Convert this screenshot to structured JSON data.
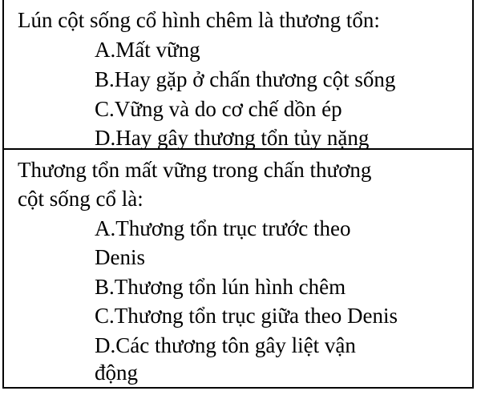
{
  "questions": [
    {
      "lines": [
        "Lún cột sống cổ hình chêm là thương tổn:"
      ],
      "options": [
        "A.Mất vững",
        "B.Hay gặp ở chấn thương cột sống",
        "C.Vững và do cơ chế dồn ép",
        "D.Hay gây thương tổn tủy nặng"
      ]
    },
    {
      "lines": [
        "Thương tổn mất vững trong chấn thương",
        "cột sống cổ là:"
      ],
      "options": [
        "A.Thương tổn trục trước  theo",
        "Denis",
        "B.Thương tổn lún hình chêm",
        "C.Thương tổn trục giữa theo Denis",
        "D.Các thương tôn gây liệt vận",
        "động"
      ]
    }
  ]
}
